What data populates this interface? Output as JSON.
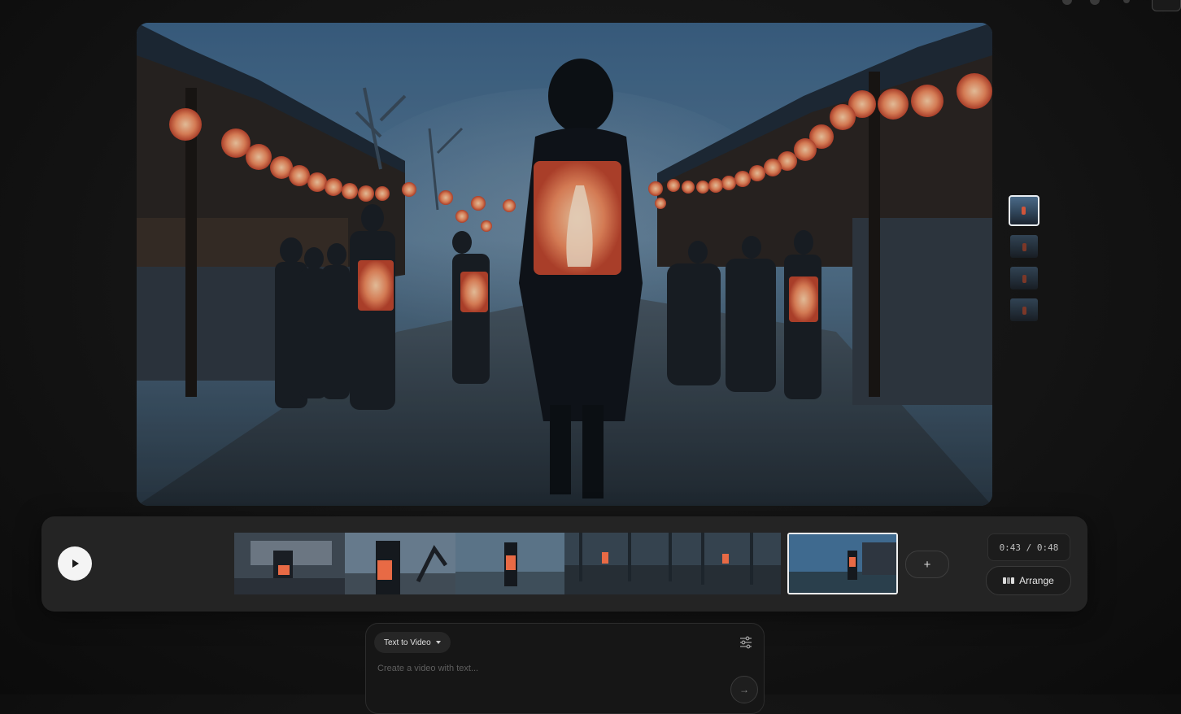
{
  "viewer": {
    "image_label": "foggy-lantern-street-scene",
    "side_thumbnails": [
      {
        "icon": "clip-thumbnail",
        "active": true
      },
      {
        "icon": "clip-thumbnail",
        "active": false
      },
      {
        "icon": "clip-thumbnail",
        "active": false
      },
      {
        "icon": "clip-thumbnail",
        "active": false
      }
    ]
  },
  "timeline": {
    "play_icon": "play-icon",
    "add_label": "+",
    "timecode": "0:43 / 0:48",
    "arrange_label": "Arrange",
    "arrange_icon": "arrange-icon"
  },
  "prompt": {
    "mode_label": "Text to Video",
    "mode_icon": "caret-down-icon",
    "placeholder": "Create a video with text...",
    "settings_icon": "sliders-icon",
    "submit_icon": "arrow-right-icon"
  },
  "colors": {
    "background": "#141414",
    "panel": "#242424",
    "lantern": "#f08a5d",
    "sky": "#2f4d6e"
  }
}
